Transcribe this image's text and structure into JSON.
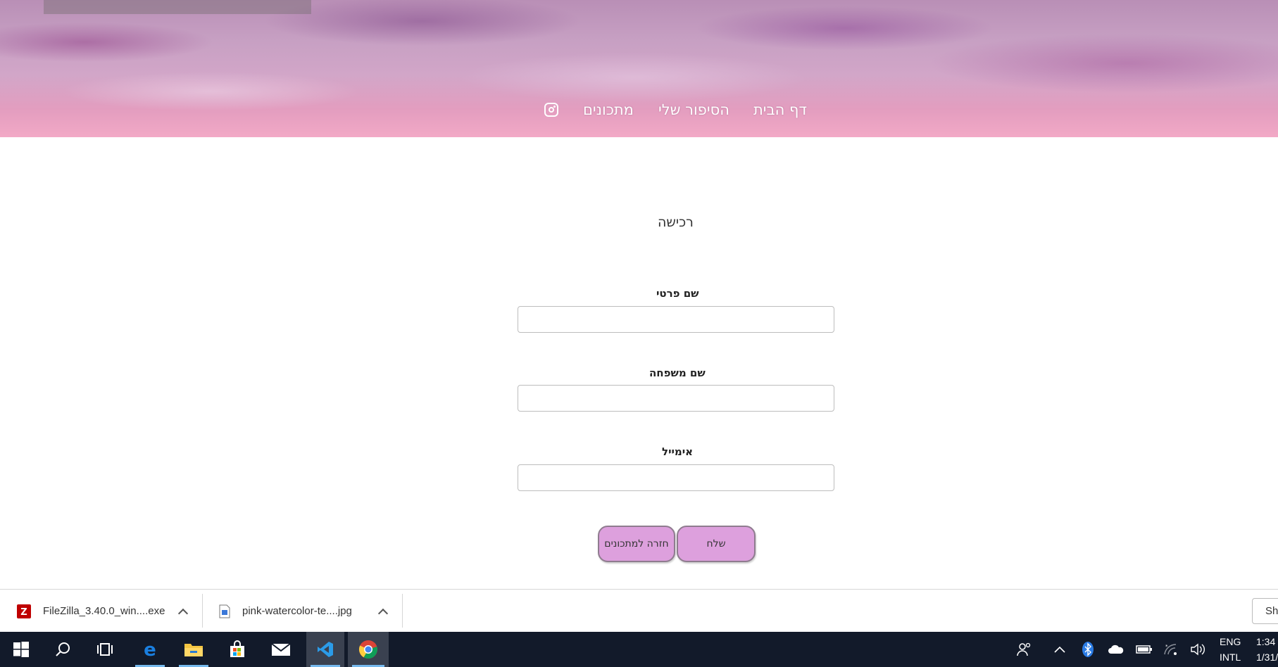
{
  "nav": {
    "items": [
      "דף הבית",
      "הסיפור שלי",
      "מתכונים"
    ],
    "instagram_icon": "instagram-icon"
  },
  "form": {
    "title": "רכישה",
    "first_name_label": "שם פרטי",
    "first_name_value": "",
    "last_name_label": "שם משפחה",
    "last_name_value": "",
    "email_label": "אימייל",
    "email_value": "",
    "submit_label": "שלח",
    "back_label": "חזרה למתכונים"
  },
  "downloads": {
    "items": [
      {
        "name": "FileZilla_3.40.0_win....exe",
        "icon": "filezilla-icon"
      },
      {
        "name": "pink-watercolor-te....jpg",
        "icon": "image-file-icon"
      }
    ],
    "show_all_label": "Sh"
  },
  "taskbar": {
    "apps": [
      "windows-start-icon",
      "search-icon",
      "task-view-icon",
      "edge-icon",
      "file-explorer-icon",
      "store-icon",
      "mail-icon",
      "vscode-icon",
      "chrome-icon"
    ],
    "lang_line1": "ENG",
    "lang_line2": "INTL",
    "time": "1:34",
    "date": "1/31/"
  },
  "colors": {
    "button_fill": "#dda0dd",
    "taskbar_bg": "#121a2a"
  }
}
